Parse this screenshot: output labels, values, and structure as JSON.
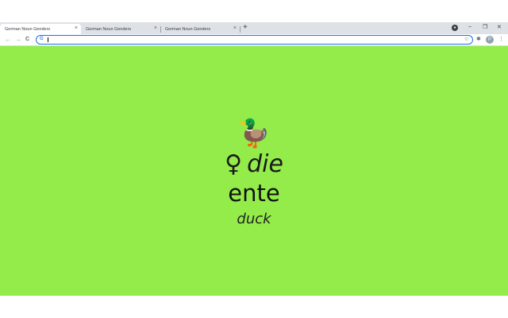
{
  "browser": {
    "tabs": [
      {
        "title": "German Noun Genders",
        "active": true
      },
      {
        "title": "German Noun Genders",
        "active": false
      },
      {
        "title": "German Noun Genders",
        "active": false
      }
    ],
    "new_tab_glyph": "+",
    "close_glyph": "×",
    "window_controls": {
      "minimize": "–",
      "maximize": "❐",
      "close": "✕"
    },
    "profile_badge": "●",
    "omnibox": {
      "value": "",
      "search_engine_glyph": "G",
      "bookmark_glyph": "☆"
    },
    "nav": {
      "back": "←",
      "forward": "→",
      "reload": "C"
    },
    "toolbar_icons": {
      "extensions": "✱",
      "avatar": "P",
      "menu": "⋮"
    }
  },
  "card": {
    "emoji": "🦆",
    "emoji_icon": "duck-icon",
    "gender_symbol": "♀",
    "article": "die",
    "noun": "ente",
    "translation": "duck",
    "background_color": "#93ec4a"
  }
}
